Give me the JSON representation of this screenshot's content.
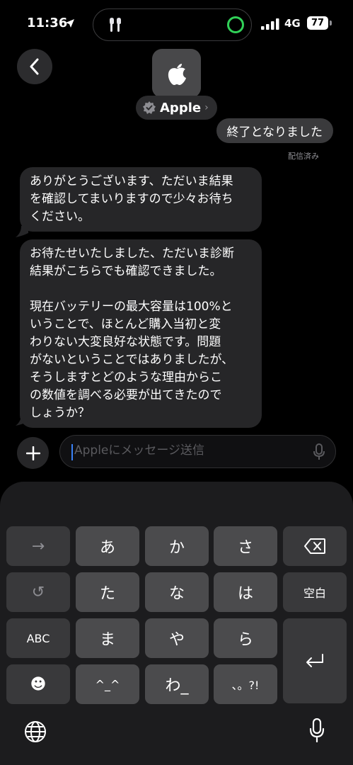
{
  "status": {
    "time": "11:36",
    "network": "4G",
    "battery": "77"
  },
  "header": {
    "contact_name": "Apple"
  },
  "messages": {
    "sent": "終了となりました",
    "sent_status": "配信済み",
    "received": [
      "ありがとうございます、ただいま結果\nを確認してまいりますので少々お待ち\nください。",
      "お待たせいたしました、ただいま診断\n結果がこちらでも確認できました。\n\n現在バッテリーの最大容量は100%と\nいうことで、ほとんど購入当初と変\nわりない大変良好な状態です。問題\nがないということではありましたが、\nそうしますとどのような理由からこ\nの数値を調べる必要が出てきたので\nしょうか？"
    ]
  },
  "compose": {
    "placeholder": "Appleにメッセージ送信"
  },
  "keyboard": {
    "keys": {
      "arrow": "→",
      "a": "あ",
      "ka": "か",
      "sa": "さ",
      "undo": "↺",
      "ta": "た",
      "na": "な",
      "ha": "は",
      "space": "空白",
      "abc": "ABC",
      "ma": "ま",
      "ya": "や",
      "ra": "ら",
      "emoji": "☻",
      "kaomoji": "^_^",
      "wa": "わ_",
      "punct": "、。?!"
    }
  },
  "colors": {
    "accent": "#3a82f7",
    "ring": "#31d158",
    "sent_bubble": "#3a3a3c",
    "received_bubble": "#262628"
  }
}
